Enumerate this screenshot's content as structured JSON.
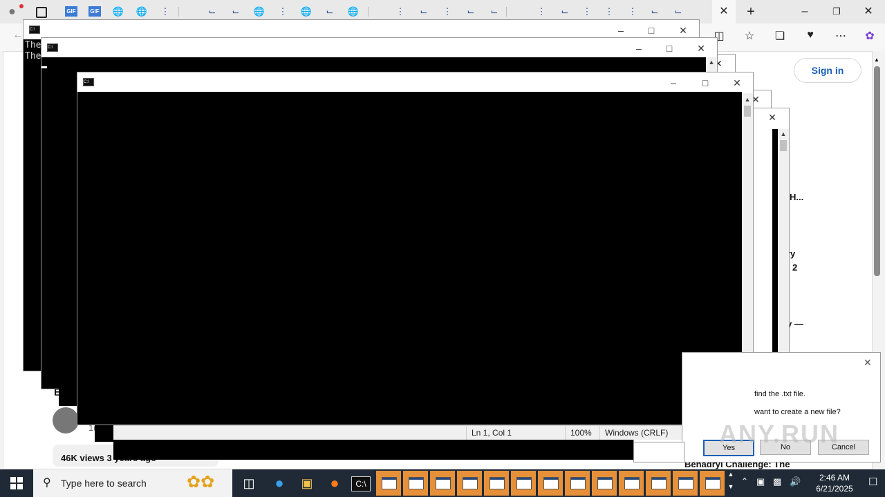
{
  "browser": {
    "signin_label": "Sign in",
    "page_fragments": [
      "H...",
      "ry",
      "2",
      "y —",
      "E"
    ],
    "video_meta": "46K views  3 years ago",
    "video_title_fragment": "Benadryl Challenge: The",
    "count_fragment": "1("
  },
  "cmd_window_1": {
    "lines": [
      "The",
      "The"
    ]
  },
  "notepad_status": {
    "position": "Ln 1, Col 1",
    "zoom": "100%",
    "line_ending": "Windows (CRLF)"
  },
  "dialog": {
    "message_line1": "find the .txt file.",
    "message_line2": "want to create a new file?",
    "yes_label": "Yes",
    "no_label": "No",
    "cancel_label": "Cancel"
  },
  "watermark": "ANY.RUN",
  "taskbar": {
    "search_placeholder": "Type here to search",
    "time": "2:46 AM",
    "date": "6/21/2025",
    "open_window_count": 13
  },
  "colors": {
    "taskbar_bg": "#1f2a36",
    "taskbar_window_accent": "#e6913a",
    "console_bg": "#000000",
    "link_blue": "#1a5fb4"
  }
}
